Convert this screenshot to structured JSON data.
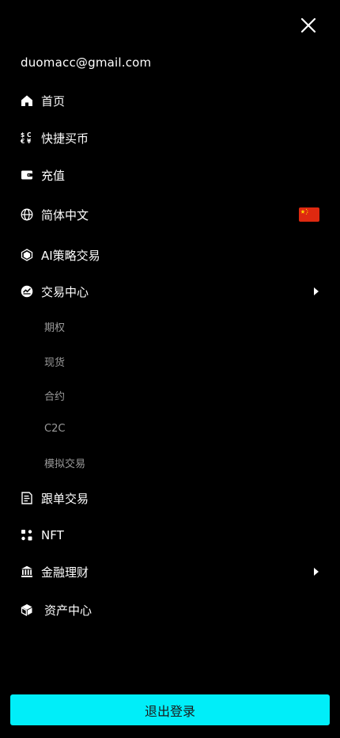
{
  "user": {
    "email": "duomacc@gmail.com"
  },
  "menu": {
    "home": {
      "label": "首页",
      "icon": "home-icon"
    },
    "quick_buy": {
      "label": "快捷买币",
      "icon": "currency-exchange-icon"
    },
    "deposit": {
      "label": "充值",
      "icon": "wallet-icon"
    },
    "language": {
      "label": "简体中文",
      "icon": "globe-icon",
      "flag": "china-flag-icon"
    },
    "ai_strategy": {
      "label": "AI策略交易",
      "icon": "ai-cube-icon"
    },
    "trading_center": {
      "label": "交易中心",
      "icon": "trade-swap-icon",
      "expanded": true,
      "children": [
        "期权",
        "现货",
        "合约",
        "C2C",
        "模拟交易"
      ]
    },
    "copy_trading": {
      "label": "跟单交易",
      "icon": "document-icon"
    },
    "nft": {
      "label": "NFT",
      "icon": "nft-icon"
    },
    "finance": {
      "label": "金融理财",
      "icon": "bank-icon"
    },
    "assets": {
      "label": "资产中心",
      "icon": "assets-cube-icon"
    }
  },
  "logout_button": {
    "label": "退出登录"
  },
  "colors": {
    "background": "#000000",
    "accent": "#00eef9",
    "text": "#ffffff",
    "muted_text": "#9a9a9a"
  }
}
